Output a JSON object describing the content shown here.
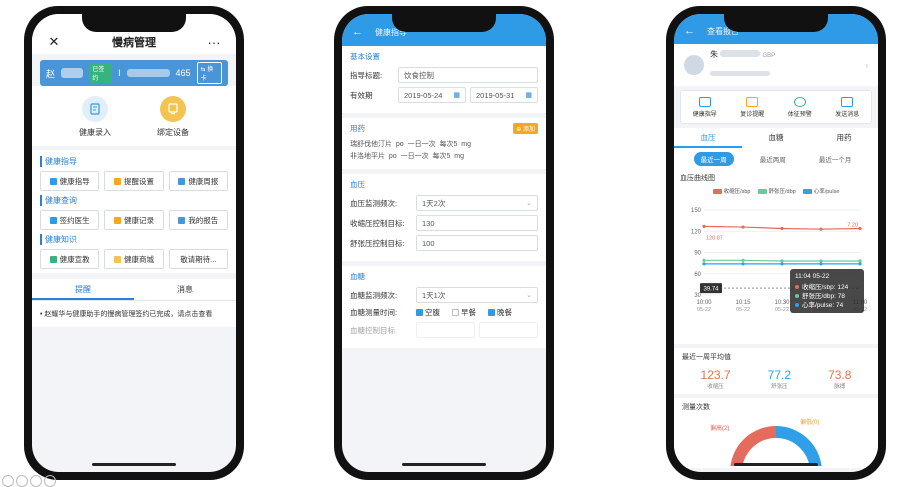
{
  "phone1": {
    "title": "慢病管理",
    "close_icon": "close-icon",
    "more_label": "···",
    "user_name": "赵",
    "signed_badge": "已签约",
    "user_id_prefix": "I",
    "user_id_suffix": "465",
    "switch_card": "⇆ 换卡",
    "actions": [
      {
        "label": "健康录入",
        "icon": "edit-note-icon",
        "color": "#e3eefc"
      },
      {
        "label": "绑定设备",
        "icon": "device-icon",
        "color": "#f3c451"
      }
    ],
    "sections": [
      {
        "title": "健康指导",
        "items": [
          {
            "label": "健康指导",
            "color": "#2f9be6"
          },
          {
            "label": "提醒设置",
            "color": "#f5a623"
          },
          {
            "label": "健康周报",
            "color": "#4a95d8"
          }
        ]
      },
      {
        "title": "健康查询",
        "items": [
          {
            "label": "签约医生",
            "color": "#2f9be6"
          },
          {
            "label": "健康记录",
            "color": "#f5a623"
          },
          {
            "label": "我的报告",
            "color": "#4a95d8"
          }
        ]
      },
      {
        "title": "健康知识",
        "items": [
          {
            "label": "健康宣教",
            "color": "#36b37e"
          },
          {
            "label": "健康商城",
            "color": "#f3c451"
          },
          {
            "label": "敬请期待...",
            "color": ""
          }
        ]
      }
    ],
    "tabs": [
      "提醒",
      "消息"
    ],
    "message": "赵耀华与健康助手的慢病管理签约已完成，请点击查看"
  },
  "phone2": {
    "header_title": "健康指导",
    "basic": {
      "heading": "基本设置",
      "title_label": "指导标题:",
      "title_value": "饮食控制",
      "validity_label": "有效期",
      "start_date": "2019-05-24",
      "end_date": "2019-05-31"
    },
    "meds": {
      "heading": "用药",
      "add_label": "⊕ 添加",
      "lines": [
        {
          "name": "瑞舒伐他汀片",
          "route": "po",
          "freq": "一日一次",
          "dose_label": "每次5",
          "unit": "mg"
        },
        {
          "name": "非洛地平片",
          "route": "po",
          "freq": "一日一次",
          "dose_label": "每次5",
          "unit": "mg"
        }
      ]
    },
    "bp": {
      "heading": "血压",
      "freq_label": "血压监测频次:",
      "freq_value": "1天2次",
      "sys_label": "收缩压控制目标:",
      "sys_value": "130",
      "dia_label": "舒张压控制目标:",
      "dia_value": "100"
    },
    "glucose": {
      "heading": "血糖",
      "freq_label": "血糖监测频次:",
      "freq_value": "1天1次",
      "time_label": "血糖测量时间:",
      "options": [
        {
          "label": "空腹",
          "checked": true
        },
        {
          "label": "早餐",
          "checked": false
        },
        {
          "label": "晚餐",
          "checked": true
        }
      ],
      "target_label": "血糖控制目标"
    }
  },
  "phone3": {
    "header_title": "查看报告",
    "profile_name": "朱",
    "profile_sub": "GBP",
    "icons": [
      {
        "label": "健康指导"
      },
      {
        "label": "复诊提醒"
      },
      {
        "label": "体征预警"
      },
      {
        "label": "发送消息"
      }
    ],
    "tabs": [
      "血压",
      "血糖",
      "用药"
    ],
    "ranges": [
      "最近一周",
      "最近两周",
      "最近一个月"
    ],
    "chart_title": "血压曲线图",
    "legend": [
      {
        "name": "收缩压/sbp",
        "color": "#e56b5c"
      },
      {
        "name": "舒张压/dbp",
        "color": "#6cc99a"
      },
      {
        "name": "心率/pulse",
        "color": "#2fa0e8"
      }
    ],
    "tooltip": {
      "time": "11:04 05-22",
      "rows": [
        "收缩压/sbp: 124",
        "舒张压/dbp: 78",
        "心率/pulse: 74"
      ]
    },
    "avg_heading": "最近一周平均值",
    "averages": [
      {
        "value": "123.7",
        "label": "收缩压",
        "color": "#e8734a"
      },
      {
        "value": "77.2",
        "label": "舒张压",
        "color": "#2fa0e8"
      },
      {
        "value": "73.8",
        "label": "脉搏",
        "color": "#e8734a"
      }
    ],
    "count_heading": "测量次数",
    "donut_labels": [
      "偏高(2)",
      "偏低(0)"
    ]
  },
  "chart_data": {
    "type": "line",
    "title": "血压曲线图",
    "x": [
      "10:00\n05-22",
      "10:15\n05-22",
      "10:30\n05-22",
      "10:45\n05-22",
      "11:00\n05-22"
    ],
    "xticks": [
      "10:00",
      "10:15",
      "10:30",
      "10:45",
      "11:00"
    ],
    "xsub": "05-22",
    "yticks": [
      "150",
      "120",
      "90",
      "60",
      "30"
    ],
    "ylim": [
      30,
      160
    ],
    "series": [
      {
        "name": "收缩压/sbp",
        "values": [
          127,
          126,
          124,
          123,
          124
        ],
        "color": "#e56b5c"
      },
      {
        "name": "舒张压/dbp",
        "values": [
          79,
          79,
          78,
          78,
          78
        ],
        "color": "#6cc99a"
      },
      {
        "name": "心率/pulse",
        "values": [
          74,
          74,
          74,
          74,
          74
        ],
        "color": "#2fa0e8"
      }
    ],
    "markers": {
      "left_value": "120.87",
      "crosshair_value": "39.74",
      "right_value": "7.20"
    }
  }
}
